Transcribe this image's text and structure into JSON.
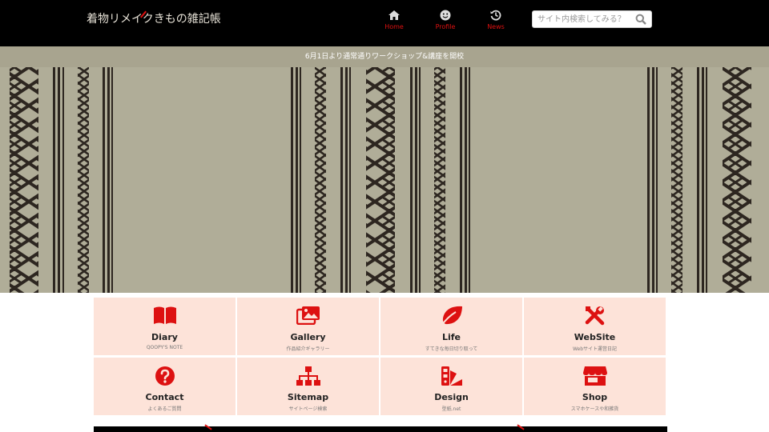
{
  "header": {
    "logo_text": "着物リメイク",
    "logo_text_2": "きもの雑記帳",
    "nav": [
      {
        "label": "Home",
        "icon": "home-icon"
      },
      {
        "label": "Profile",
        "icon": "smile-icon"
      },
      {
        "label": "News",
        "icon": "history-icon"
      }
    ],
    "search": {
      "placeholder": "サイト内検索してみる？"
    }
  },
  "notice": {
    "text": "6月1日より通常通りワークショップ&講座を開校"
  },
  "tiles": [
    {
      "title": "Diary",
      "sub": "QOOPY'S NOTE",
      "icon": "book-icon"
    },
    {
      "title": "Gallery",
      "sub": "作品紹介ギャラリー",
      "icon": "images-icon"
    },
    {
      "title": "Life",
      "sub": "すてきな毎日切り取って",
      "icon": "leaf-icon"
    },
    {
      "title": "WebSite",
      "sub": "Webサイト運営日記",
      "icon": "tools-icon"
    },
    {
      "title": "Contact",
      "sub": "よくあるご質問",
      "icon": "question-icon"
    },
    {
      "title": "Sitemap",
      "sub": "サイトページ検索",
      "icon": "sitemap-icon"
    },
    {
      "title": "Design",
      "sub": "型紙.net",
      "icon": "swatchbook-icon"
    },
    {
      "title": "Shop",
      "sub": "スマホケースや和雑貨",
      "icon": "store-icon"
    }
  ],
  "colors": {
    "header_bg": "#000000",
    "accent_red": "#dd1111",
    "notice_bg": "#a8a48f",
    "hero_bg": "#b0ad98",
    "pattern_dark": "#2d2620",
    "tile_bg": "#fde3d9"
  }
}
